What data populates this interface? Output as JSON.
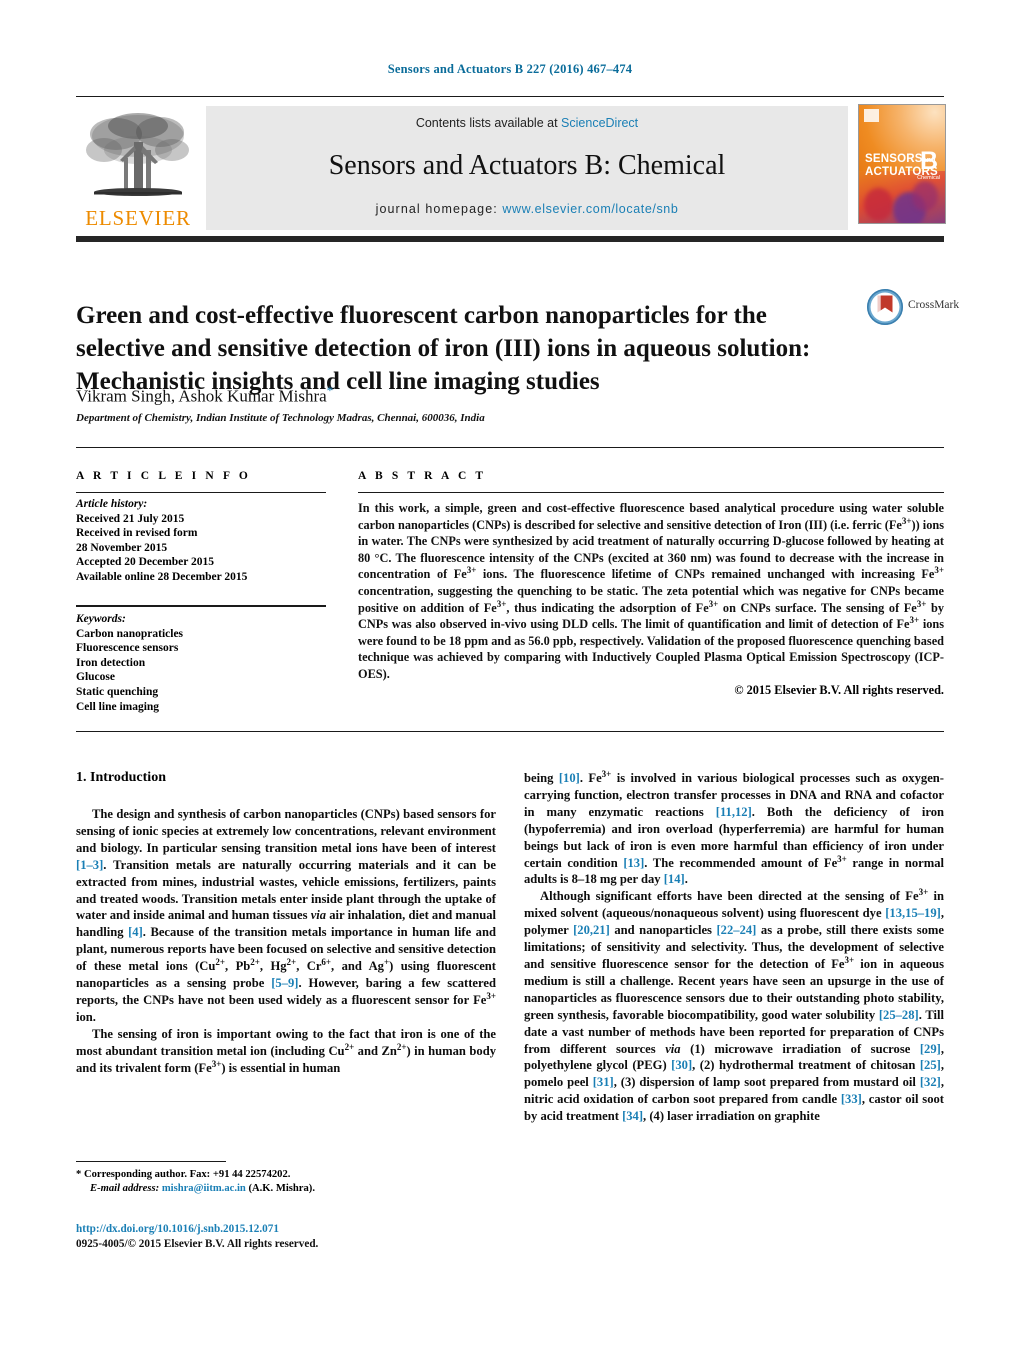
{
  "running_head": "Sensors and Actuators B 227 (2016) 467–474",
  "journal_header": {
    "publisher_name": "ELSEVIER",
    "contents_prefix": "Contents lists available at",
    "contents_link": "ScienceDirect",
    "journal_title": "Sensors and Actuators B: Chemical",
    "homepage_label": "journal homepage:",
    "homepage_url": "www.elsevier.com/locate/snb",
    "cover": {
      "line1": "SENSORS",
      "line1_small": "and",
      "line2": "ACTUATORS",
      "volume_letter": "B",
      "sub_label": "Chemical"
    }
  },
  "article": {
    "title": "Green and cost-effective fluorescent carbon nanoparticles for the selective and sensitive detection of iron (III) ions in aqueous solution: Mechanistic insights and cell line imaging studies",
    "authors": "Vikram Singh, Ashok Kumar Mishra",
    "corresponding_marker": "*",
    "affiliation": "Department of Chemistry, Indian Institute of Technology Madras, Chennai, 600036, India",
    "crossmark_label": "CrossMark"
  },
  "article_info": {
    "heading": "A R T I C L E   I N F O",
    "history_label": "Article history:",
    "history": [
      "Received 21 July 2015",
      "Received in revised form",
      "28 November 2015",
      "Accepted 20 December 2015",
      "Available online 28 December 2015"
    ],
    "keywords_label": "Keywords:",
    "keywords": [
      "Carbon nanopraticles",
      "Fluorescence sensors",
      "Iron detection",
      "Glucose",
      "Static quenching",
      "Cell line imaging"
    ]
  },
  "abstract": {
    "heading": "A B S T R A C T",
    "text_parts": [
      "In this work, a simple, green and cost-effective fluorescence based analytical procedure using water soluble carbon nanoparticles (CNPs) is described for selective and sensitive detection of Iron (III) (i.e. ferric (Fe",
      "3+",
      ")) ions in water. The CNPs were synthesized by acid treatment of naturally occurring D-glucose followed by heating at 80 °C. The fluorescence intensity of the CNPs (excited at 360 nm) was found to decrease with the increase in concentration of Fe",
      "3+",
      " ions. The fluorescence lifetime of CNPs remained unchanged with increasing Fe",
      "3+",
      " concentration, suggesting the quenching to be static. The zeta potential which was negative for CNPs became positive on addition of Fe",
      "3+",
      ", thus indicating the adsorption of Fe",
      "3+",
      " on CNPs surface. The sensing of Fe",
      "3+",
      " by CNPs was also observed in-vivo using DLD cells. The limit of quantification and limit of detection of Fe",
      "3+",
      " ions were found to be 18 ppm and as 56.0 ppb, respectively. Validation of the proposed fluorescence quenching based technique was achieved by comparing with Inductively Coupled Plasma Optical Emission Spectroscopy (ICP-OES)."
    ],
    "copyright": "© 2015 Elsevier B.V. All rights reserved."
  },
  "body": {
    "section_number_title": "1.  Introduction",
    "left_paragraph_1": "The design and synthesis of carbon nanoparticles (CNPs) based sensors for sensing of ionic species at extremely low concentrations, relevant environment and biology. In particular sensing transition metal ions have been of interest [1–3]. Transition metals are naturally occurring materials and it can be extracted from mines, industrial wastes, vehicle emissions, fertilizers, paints and treated woods. Transition metals enter inside plant through the uptake of water and inside animal and human tissues via air inhalation, diet and manual handling [4]. Because of the transition metals importance in human life and plant, numerous reports have been focused on selective and sensitive detection of these metal ions (Cu2+, Pb2+, Hg2+, Cr6+, and Ag+) using fluorescent nanoparticles as a sensing probe [5–9]. However, baring a few scattered reports, the CNPs have not been used widely as a fluorescent sensor for Fe3+ ion.",
    "left_paragraph_2": "The sensing of iron is important owing to the fact that iron is one of the most abundant transition metal ion (including Cu2+ and Zn2+) in human body and its trivalent form (Fe3+) is essential in human",
    "right_paragraph_1": "being [10]. Fe3+ is involved in various biological processes such as oxygen-carrying function, electron transfer processes in DNA and RNA and cofactor in many enzymatic reactions [11,12]. Both the deficiency of iron (hypoferremia) and iron overload (hyperferremia) are harmful for human beings but lack of iron is even more harmful than efficiency of iron under certain condition [13]. The recommended amount of Fe3+ range in normal adults is 8–18 mg per day [14].",
    "right_paragraph_2": "Although significant efforts have been directed at the sensing of Fe3+ in mixed solvent (aqueous/nonaqueous solvent) using fluorescent dye [13,15–19], polymer [20,21] and nanoparticles [22–24] as a probe, still there exists some limitations; of sensitivity and selectivity. Thus, the development of selective and sensitive fluorescence sensor for the detection of Fe3+ ion in aqueous medium is still a challenge. Recent years have seen an upsurge in the use of nanoparticles as fluorescence sensors due to their outstanding photo stability, green synthesis, favorable biocompatibility, good water solubility [25–28]. Till date a vast number of methods have been reported for preparation of CNPs from different sources via (1) microwave irradiation of sucrose [29], polyethylene glycol (PEG) [30], (2) hydrothermal treatment of chitosan [25], pomelo peel [31], (3) dispersion of lamp soot prepared from mustard oil [32], nitric acid oxidation of carbon soot prepared from candle [33], castor oil soot by acid treatment [34], (4) laser irradiation on graphite"
  },
  "footer": {
    "corresponding_note": "* Corresponding author. Fax: +91 44 22574202.",
    "email_label": "E-mail address:",
    "email": "mishra@iitm.ac.in",
    "email_suffix": "(A.K. Mishra).",
    "doi": "http://dx.doi.org/10.1016/j.snb.2015.12.071",
    "issn_line": "0925-4005/© 2015 Elsevier B.V. All rights reserved."
  },
  "colors": {
    "link": "#1a7fb5",
    "runhead": "#0a6c9a",
    "elsevier_orange": "#ed8b00",
    "banner_bg": "#e8e8e8",
    "bar": "#262626"
  }
}
